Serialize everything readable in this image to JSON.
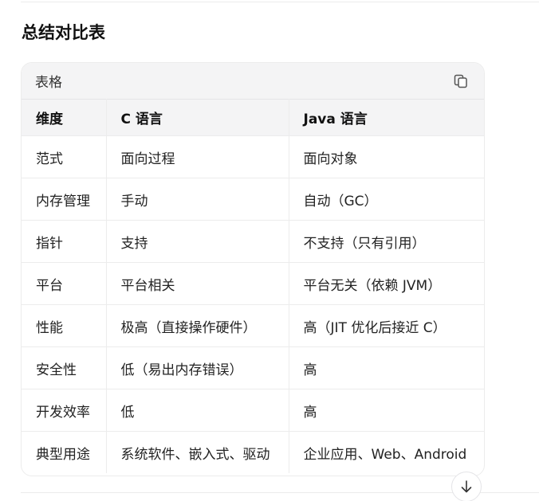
{
  "section": {
    "title": "总结对比表"
  },
  "table_card": {
    "label": "表格",
    "copy_icon": "copy-icon",
    "headers": [
      "维度",
      "C 语言",
      "Java 语言"
    ],
    "rows": [
      [
        "范式",
        "面向过程",
        "面向对象"
      ],
      [
        "内存管理",
        "手动",
        "自动（GC）"
      ],
      [
        "指针",
        "支持",
        "不支持（只有引用）"
      ],
      [
        "平台",
        "平台相关",
        "平台无关（依赖 JVM）"
      ],
      [
        "性能",
        "极高（直接操作硬件）",
        "高（JIT 优化后接近 C）"
      ],
      [
        "安全性",
        "低（易出内存错误）",
        "高"
      ],
      [
        "开发效率",
        "低",
        "高"
      ],
      [
        "典型用途",
        "系统软件、嵌入式、驱动",
        "企业应用、Web、Android"
      ]
    ]
  },
  "scroll_button": {
    "icon": "arrow-down-icon"
  }
}
